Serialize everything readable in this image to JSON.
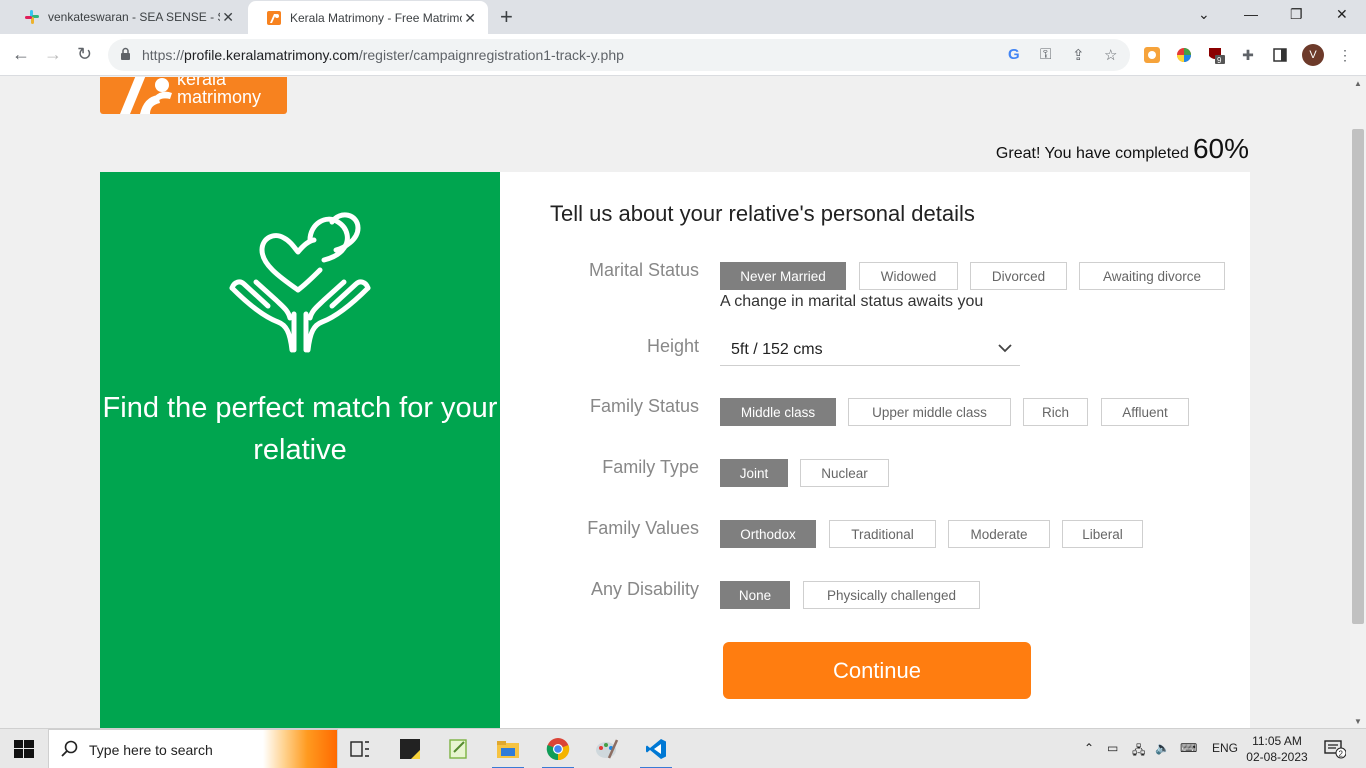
{
  "browser": {
    "tabs": [
      {
        "title": "venkateswaran - SEA SENSE - Sla",
        "favicon": "slack-icon"
      },
      {
        "title": "Kerala Matrimony - Free Matrimo",
        "favicon": "kerala-matrimony-icon",
        "active": true
      }
    ],
    "url": {
      "scheme": "https://",
      "host": "profile.keralamatrimony.com",
      "path": "/register/campaignregistration1-track-y.php"
    },
    "profile_initial": "V",
    "extension_badge": "9"
  },
  "page": {
    "logo": {
      "line1": "kerala",
      "line2": "matrimony"
    },
    "progress": {
      "text": "Great! You have completed",
      "percent": "60%"
    },
    "left_panel": {
      "tagline": "Find the perfect match for your relative"
    },
    "form": {
      "heading": "Tell us about your relative's personal details",
      "marital_status": {
        "label": "Marital Status",
        "options": [
          "Never Married",
          "Widowed",
          "Divorced",
          "Awaiting divorce"
        ],
        "selected": "Never Married",
        "note": "A change in marital status awaits you"
      },
      "height": {
        "label": "Height",
        "value": "5ft / 152 cms"
      },
      "family_status": {
        "label": "Family Status",
        "options": [
          "Middle class",
          "Upper middle class",
          "Rich",
          "Affluent"
        ],
        "selected": "Middle class"
      },
      "family_type": {
        "label": "Family Type",
        "options": [
          "Joint",
          "Nuclear"
        ],
        "selected": "Joint"
      },
      "family_values": {
        "label": "Family Values",
        "options": [
          "Orthodox",
          "Traditional",
          "Moderate",
          "Liberal"
        ],
        "selected": "Orthodox"
      },
      "disability": {
        "label": "Any Disability",
        "options": [
          "None",
          "Physically challenged"
        ],
        "selected": "None"
      },
      "continue_label": "Continue"
    },
    "colors": {
      "green_panel": "#00a54f",
      "orange_button": "#ff7d10",
      "selected_option": "#7f7f7f",
      "logo_orange": "#f7821f"
    }
  },
  "taskbar": {
    "search_placeholder": "Type here to search",
    "language": "ENG",
    "time": "11:05 AM",
    "date": "02-08-2023",
    "notification_count": "2"
  }
}
